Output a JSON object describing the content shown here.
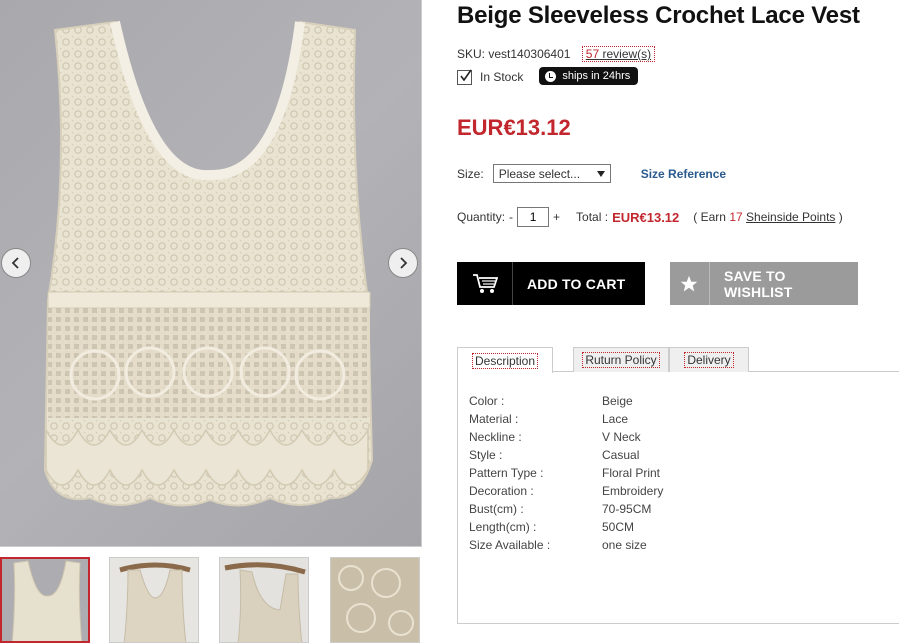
{
  "product": {
    "title": "Beige Sleeveless Crochet Lace Vest",
    "sku_label": "SKU:",
    "sku": "vest140306401",
    "review_count": "57",
    "review_label": "review(s)",
    "stock": "In Stock",
    "ships_badge": "ships in 24hrs",
    "price": "EUR€13.12"
  },
  "options": {
    "size_label": "Size:",
    "size_selected": "Please select...",
    "size_reference": "Size Reference",
    "quantity_label": "Quantity:",
    "quantity_minus": "-",
    "quantity_value": "1",
    "quantity_plus": "+",
    "total_label": "Total :",
    "total_value": "EUR€13.12",
    "earn_open": "( Earn",
    "earn_points": "17",
    "earn_link": "Sheinside Points",
    "earn_close": ")"
  },
  "actions": {
    "add_to_cart": "ADD TO CART",
    "save_to_wishlist": "SAVE TO WISHLIST"
  },
  "tabs": [
    {
      "label": "Description"
    },
    {
      "label": "Ruturn Policy"
    },
    {
      "label": "Delivery"
    }
  ],
  "specs": [
    {
      "label": "Color :",
      "value": "Beige"
    },
    {
      "label": "Material :",
      "value": "Lace"
    },
    {
      "label": "Neckline :",
      "value": "V Neck"
    },
    {
      "label": "Style :",
      "value": "Casual"
    },
    {
      "label": "Pattern Type :",
      "value": "Floral Print"
    },
    {
      "label": "Decoration :",
      "value": "Embroidery"
    },
    {
      "label": "Bust(cm) :",
      "value": "70-95CM"
    },
    {
      "label": "Length(cm) :",
      "value": "50CM"
    },
    {
      "label": "Size Available :",
      "value": "one size"
    }
  ],
  "colors": {
    "accent": "#c1272d",
    "link_blue": "#2b5b8e",
    "cart_button": "#000000",
    "wishlist_button": "#9b9b9b"
  },
  "icons": {
    "prev": "chevron-left-icon",
    "next": "chevron-right-icon",
    "cart": "cart-icon",
    "wishlist": "star-icon",
    "stock": "checkmark-icon",
    "ships": "clock-icon",
    "select": "caret-down-icon"
  }
}
